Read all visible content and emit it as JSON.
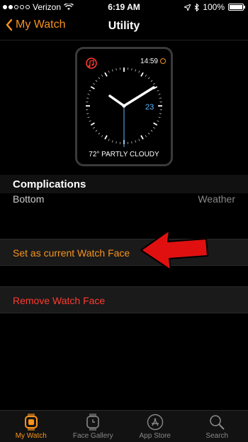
{
  "status": {
    "carrier": "Verizon",
    "time": "6:19 AM",
    "battery": "100%"
  },
  "nav": {
    "back_label": "My Watch",
    "title": "Utility"
  },
  "watch_face": {
    "time": "14:59",
    "date": "23",
    "weather": "72° PARTLY CLOUDY"
  },
  "complications": {
    "header": "Complications",
    "bottom_label": "Bottom",
    "bottom_value": "Weather"
  },
  "actions": {
    "set_current": "Set as current Watch Face",
    "remove": "Remove Watch Face"
  },
  "tabs": [
    {
      "label": "My Watch",
      "icon": "watch-icon",
      "active": true
    },
    {
      "label": "Face Gallery",
      "icon": "face-gallery-icon",
      "active": false
    },
    {
      "label": "App Store",
      "icon": "app-store-icon",
      "active": false
    },
    {
      "label": "Search",
      "icon": "search-icon",
      "active": false
    }
  ],
  "colors": {
    "accent": "#f7931e",
    "destructive": "#ff3b30",
    "annotation": "#e01010"
  }
}
